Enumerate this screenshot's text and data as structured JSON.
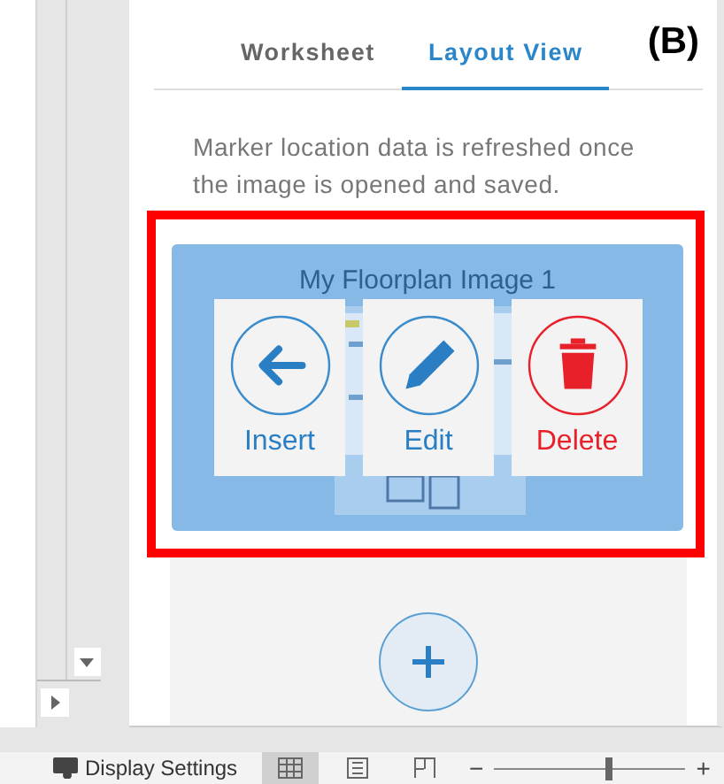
{
  "tabs": [
    {
      "label": "Worksheet",
      "selected": false
    },
    {
      "label": "Layout View",
      "selected": true
    }
  ],
  "annotation": "(B)",
  "note": "Marker location data is refreshed once the image is opened and saved.",
  "image_card": {
    "title": "My Floorplan Image 1",
    "actions": [
      {
        "kind": "insert",
        "label": "Insert"
      },
      {
        "kind": "edit",
        "label": "Edit"
      },
      {
        "kind": "delete",
        "label": "Delete"
      }
    ]
  },
  "status_bar": {
    "display_settings": "Display Settings",
    "views": [
      {
        "kind": "normal",
        "selected": true
      },
      {
        "kind": "page_layout",
        "selected": false
      },
      {
        "kind": "page_break",
        "selected": false
      }
    ],
    "zoom": {
      "minus": "−",
      "plus": "+",
      "level": 0.6
    }
  }
}
